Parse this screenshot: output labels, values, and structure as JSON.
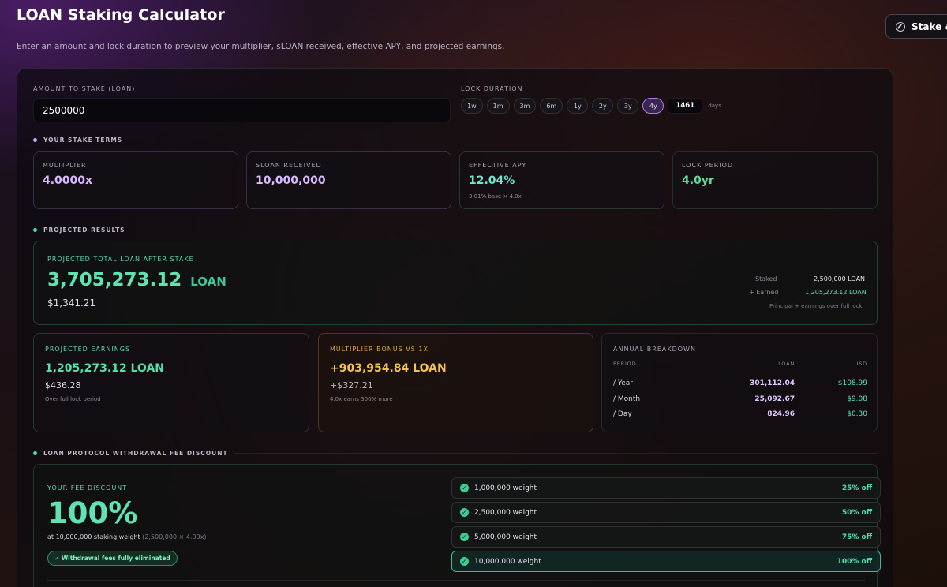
{
  "header": {
    "title": "LOAN Staking Calculator",
    "subtitle": "Enter an amount and lock duration to preview your multiplier, sLOAN received, effective APY, and projected earnings.",
    "top_button": "Stake & L"
  },
  "inputs": {
    "amount_label": "AMOUNT TO STAKE (LOAN)",
    "amount_value": "2500000",
    "duration_label": "LOCK DURATION",
    "durations": [
      "1w",
      "1m",
      "3m",
      "6m",
      "1y",
      "2y",
      "3y",
      "4y"
    ],
    "active_duration": "4y",
    "days_value": "1461",
    "days_unit": "days"
  },
  "stake_terms": {
    "section_title": "YOUR STAKE TERMS",
    "multiplier": {
      "label": "MULTIPLIER",
      "value": "4.0000x"
    },
    "sloan": {
      "label": "SLOAN RECEIVED",
      "value": "10,000,000"
    },
    "apy": {
      "label": "EFFECTIVE APY",
      "value": "12.04%",
      "sub": "3.01% base × 4.0x"
    },
    "lock": {
      "label": "LOCK PERIOD",
      "value": "4.0yr"
    }
  },
  "projected": {
    "section_title": "PROJECTED RESULTS",
    "total_label": "PROJECTED TOTAL LOAN AFTER STAKE",
    "total_value": "3,705,273.12",
    "total_unit": "LOAN",
    "total_usd": "$1,341.21",
    "staked_label": "Staked",
    "staked_value": "2,500,000 LOAN",
    "earned_label": "+ Earned",
    "earned_value": "1,205,273.12 LOAN",
    "note": "Principal + earnings over full lock"
  },
  "earnings": {
    "label": "PROJECTED EARNINGS",
    "value": "1,205,273.12 LOAN",
    "usd": "$436.28",
    "sub": "Over full lock period"
  },
  "bonus": {
    "label": "MULTIPLIER BONUS VS 1X",
    "value": "+903,954.84 LOAN",
    "usd": "+$327.21",
    "sub": "4.0x earns 300% more"
  },
  "breakdown": {
    "label": "ANNUAL BREAKDOWN",
    "headers": [
      "PERIOD",
      "LOAN",
      "USD"
    ],
    "rows": [
      {
        "period": "/ Year",
        "loan": "301,112.04",
        "usd": "$108.99"
      },
      {
        "period": "/ Month",
        "loan": "25,092.67",
        "usd": "$9.08"
      },
      {
        "period": "/ Day",
        "loan": "824.96",
        "usd": "$0.30"
      }
    ]
  },
  "fee": {
    "section_title": "LOAN PROTOCOL WITHDRAWAL FEE DISCOUNT",
    "label": "YOUR FEE DISCOUNT",
    "value": "100%",
    "weight_text": "at 10,000,000 staking weight",
    "weight_calc": "(2,500,000 × 4.00x)",
    "badge": "✓ Withdrawal fees fully eliminated",
    "tiers": [
      {
        "weight": "1,000,000 weight",
        "off": "25% off"
      },
      {
        "weight": "2,500,000 weight",
        "off": "50% off"
      },
      {
        "weight": "5,000,000 weight",
        "off": "75% off"
      },
      {
        "weight": "10,000,000 weight",
        "off": "100% off"
      }
    ]
  },
  "colors": {
    "purple": "#c9a3ff",
    "teal": "#5fe0c0",
    "green": "#49dc9c",
    "gold": "#f3c24f",
    "lavender": "#d9b9ff"
  }
}
